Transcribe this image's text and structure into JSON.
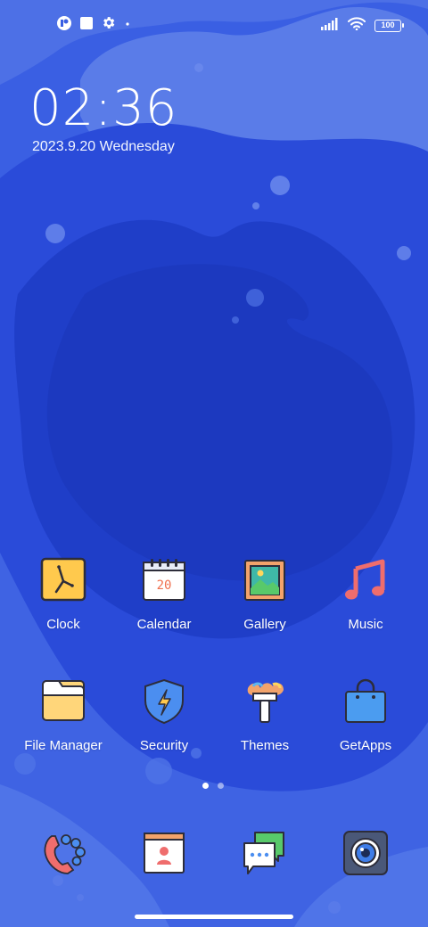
{
  "status_bar": {
    "battery": "100",
    "icons": [
      "notification-app-icon",
      "square-notification-icon",
      "gear-icon",
      "dot-icon",
      "signal-icon",
      "wifi-icon",
      "battery-icon"
    ]
  },
  "clock_widget": {
    "time": "02:36",
    "date": "2023.9.20 Wednesday"
  },
  "apps": [
    {
      "label": "Clock",
      "icon": "clock-icon"
    },
    {
      "label": "Calendar",
      "icon": "calendar-icon",
      "icon_text": "20"
    },
    {
      "label": "Gallery",
      "icon": "gallery-icon"
    },
    {
      "label": "Music",
      "icon": "music-note-icon"
    },
    {
      "label": "File Manager",
      "icon": "folder-icon"
    },
    {
      "label": "Security",
      "icon": "shield-icon"
    },
    {
      "label": "Themes",
      "icon": "paintbrush-icon"
    },
    {
      "label": "GetApps",
      "icon": "shopping-bag-icon"
    }
  ],
  "dock": [
    {
      "icon": "phone-icon"
    },
    {
      "icon": "contacts-icon"
    },
    {
      "icon": "messages-icon"
    },
    {
      "icon": "camera-icon"
    }
  ],
  "page_indicator": {
    "pages": 2,
    "current": 1
  },
  "colors": {
    "wallpaper_base": "#3a5fe3",
    "wallpaper_mid": "#2646d6",
    "wallpaper_dark": "#1f3ec8",
    "wallpaper_light": "#6487ea"
  }
}
